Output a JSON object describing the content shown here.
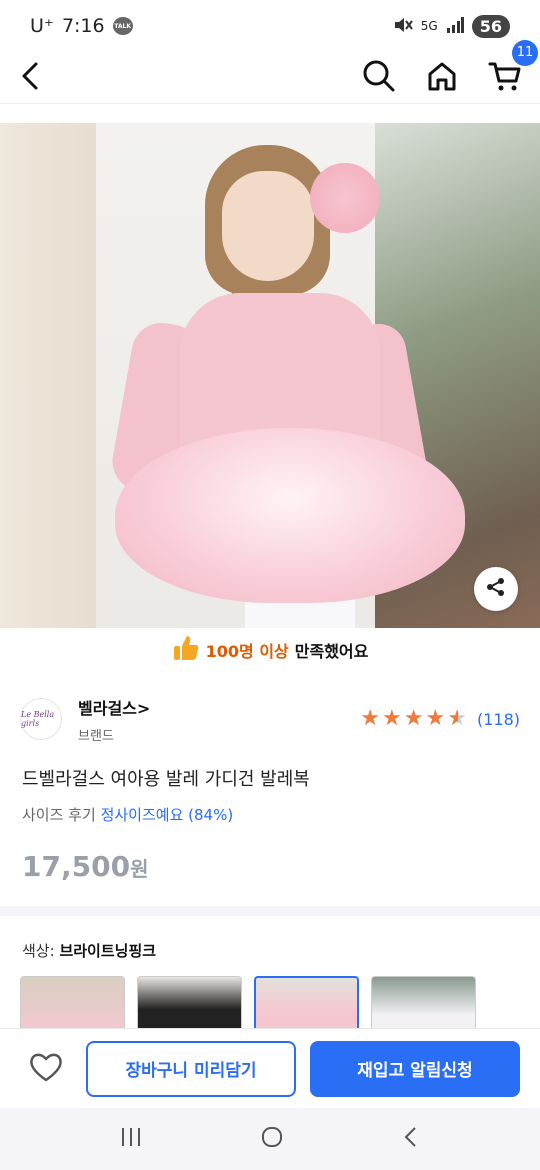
{
  "status": {
    "carrier": "U⁺",
    "time": "7:16",
    "talk": "TALK",
    "network": "5G",
    "battery": "56"
  },
  "nav": {
    "cart_count": "11"
  },
  "satisfaction": {
    "highlight": "100명 이상",
    "rest": "만족했어요"
  },
  "brand": {
    "name": "벨라걸스>",
    "subtitle": "브랜드",
    "logo_text": "Le Bella girls"
  },
  "rating": {
    "value": 4.5,
    "count": "(118)"
  },
  "product": {
    "title": "드벨라걸스 여아용 발레 가디건 발레복",
    "size_review_label": "사이즈 후기",
    "size_review_value": "정사이즈예요 (84%)",
    "price": "17,500",
    "price_unit": "원"
  },
  "color": {
    "label": "색상: ",
    "selected": "브라이트닝핑크"
  },
  "actions": {
    "cart_button": "장바구니 미리담기",
    "restock_button": "재입고 알림신청"
  },
  "colors": {
    "accent": "#2a6ef5",
    "star": "#f07a3a",
    "highlight": "#e05a00"
  }
}
